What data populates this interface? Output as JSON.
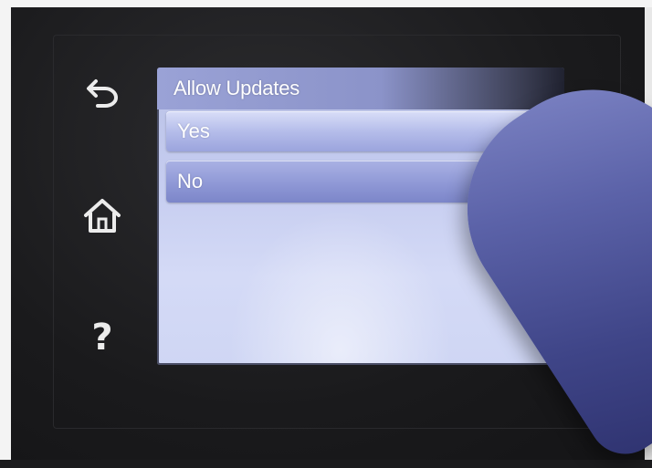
{
  "screen": {
    "title": "Allow Updates",
    "options": [
      {
        "label": "Yes"
      },
      {
        "label": "No"
      }
    ]
  },
  "side_buttons": {
    "back": "back-arrow-icon",
    "home": "home-icon",
    "help": "?"
  },
  "colors": {
    "screen_background": "#c6cdf0",
    "title_bar": "#9aa2d6",
    "option_fill": "#8f98d6",
    "bezel": "#1a1a1c"
  }
}
